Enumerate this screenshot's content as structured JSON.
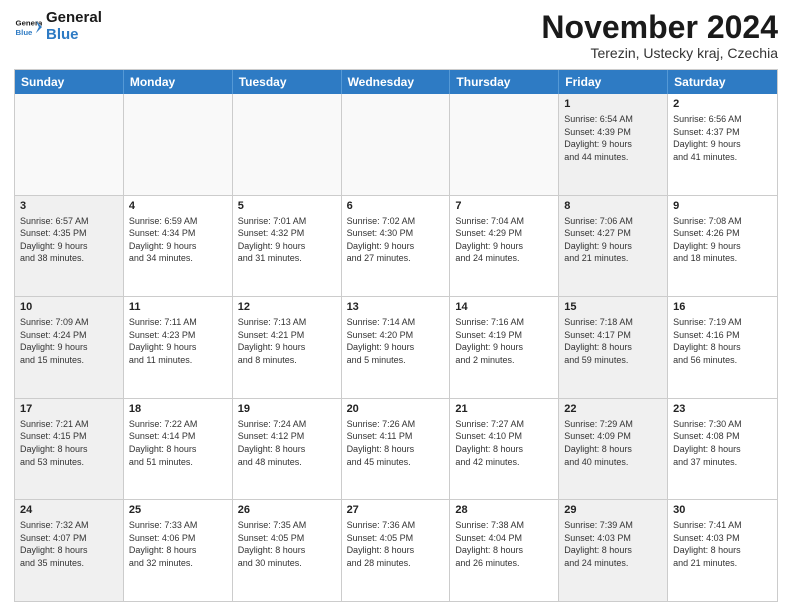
{
  "logo": {
    "line1": "General",
    "line2": "Blue"
  },
  "header": {
    "month": "November 2024",
    "location": "Terezin, Ustecky kraj, Czechia"
  },
  "weekdays": [
    "Sunday",
    "Monday",
    "Tuesday",
    "Wednesday",
    "Thursday",
    "Friday",
    "Saturday"
  ],
  "rows": [
    [
      {
        "day": "",
        "info": "",
        "empty": true
      },
      {
        "day": "",
        "info": "",
        "empty": true
      },
      {
        "day": "",
        "info": "",
        "empty": true
      },
      {
        "day": "",
        "info": "",
        "empty": true
      },
      {
        "day": "",
        "info": "",
        "empty": true
      },
      {
        "day": "1",
        "info": "Sunrise: 6:54 AM\nSunset: 4:39 PM\nDaylight: 9 hours\nand 44 minutes.",
        "shaded": true
      },
      {
        "day": "2",
        "info": "Sunrise: 6:56 AM\nSunset: 4:37 PM\nDaylight: 9 hours\nand 41 minutes.",
        "shaded": false
      }
    ],
    [
      {
        "day": "3",
        "info": "Sunrise: 6:57 AM\nSunset: 4:35 PM\nDaylight: 9 hours\nand 38 minutes.",
        "shaded": true
      },
      {
        "day": "4",
        "info": "Sunrise: 6:59 AM\nSunset: 4:34 PM\nDaylight: 9 hours\nand 34 minutes.",
        "shaded": false
      },
      {
        "day": "5",
        "info": "Sunrise: 7:01 AM\nSunset: 4:32 PM\nDaylight: 9 hours\nand 31 minutes.",
        "shaded": false
      },
      {
        "day": "6",
        "info": "Sunrise: 7:02 AM\nSunset: 4:30 PM\nDaylight: 9 hours\nand 27 minutes.",
        "shaded": false
      },
      {
        "day": "7",
        "info": "Sunrise: 7:04 AM\nSunset: 4:29 PM\nDaylight: 9 hours\nand 24 minutes.",
        "shaded": false
      },
      {
        "day": "8",
        "info": "Sunrise: 7:06 AM\nSunset: 4:27 PM\nDaylight: 9 hours\nand 21 minutes.",
        "shaded": true
      },
      {
        "day": "9",
        "info": "Sunrise: 7:08 AM\nSunset: 4:26 PM\nDaylight: 9 hours\nand 18 minutes.",
        "shaded": false
      }
    ],
    [
      {
        "day": "10",
        "info": "Sunrise: 7:09 AM\nSunset: 4:24 PM\nDaylight: 9 hours\nand 15 minutes.",
        "shaded": true
      },
      {
        "day": "11",
        "info": "Sunrise: 7:11 AM\nSunset: 4:23 PM\nDaylight: 9 hours\nand 11 minutes.",
        "shaded": false
      },
      {
        "day": "12",
        "info": "Sunrise: 7:13 AM\nSunset: 4:21 PM\nDaylight: 9 hours\nand 8 minutes.",
        "shaded": false
      },
      {
        "day": "13",
        "info": "Sunrise: 7:14 AM\nSunset: 4:20 PM\nDaylight: 9 hours\nand 5 minutes.",
        "shaded": false
      },
      {
        "day": "14",
        "info": "Sunrise: 7:16 AM\nSunset: 4:19 PM\nDaylight: 9 hours\nand 2 minutes.",
        "shaded": false
      },
      {
        "day": "15",
        "info": "Sunrise: 7:18 AM\nSunset: 4:17 PM\nDaylight: 8 hours\nand 59 minutes.",
        "shaded": true
      },
      {
        "day": "16",
        "info": "Sunrise: 7:19 AM\nSunset: 4:16 PM\nDaylight: 8 hours\nand 56 minutes.",
        "shaded": false
      }
    ],
    [
      {
        "day": "17",
        "info": "Sunrise: 7:21 AM\nSunset: 4:15 PM\nDaylight: 8 hours\nand 53 minutes.",
        "shaded": true
      },
      {
        "day": "18",
        "info": "Sunrise: 7:22 AM\nSunset: 4:14 PM\nDaylight: 8 hours\nand 51 minutes.",
        "shaded": false
      },
      {
        "day": "19",
        "info": "Sunrise: 7:24 AM\nSunset: 4:12 PM\nDaylight: 8 hours\nand 48 minutes.",
        "shaded": false
      },
      {
        "day": "20",
        "info": "Sunrise: 7:26 AM\nSunset: 4:11 PM\nDaylight: 8 hours\nand 45 minutes.",
        "shaded": false
      },
      {
        "day": "21",
        "info": "Sunrise: 7:27 AM\nSunset: 4:10 PM\nDaylight: 8 hours\nand 42 minutes.",
        "shaded": false
      },
      {
        "day": "22",
        "info": "Sunrise: 7:29 AM\nSunset: 4:09 PM\nDaylight: 8 hours\nand 40 minutes.",
        "shaded": true
      },
      {
        "day": "23",
        "info": "Sunrise: 7:30 AM\nSunset: 4:08 PM\nDaylight: 8 hours\nand 37 minutes.",
        "shaded": false
      }
    ],
    [
      {
        "day": "24",
        "info": "Sunrise: 7:32 AM\nSunset: 4:07 PM\nDaylight: 8 hours\nand 35 minutes.",
        "shaded": true
      },
      {
        "day": "25",
        "info": "Sunrise: 7:33 AM\nSunset: 4:06 PM\nDaylight: 8 hours\nand 32 minutes.",
        "shaded": false
      },
      {
        "day": "26",
        "info": "Sunrise: 7:35 AM\nSunset: 4:05 PM\nDaylight: 8 hours\nand 30 minutes.",
        "shaded": false
      },
      {
        "day": "27",
        "info": "Sunrise: 7:36 AM\nSunset: 4:05 PM\nDaylight: 8 hours\nand 28 minutes.",
        "shaded": false
      },
      {
        "day": "28",
        "info": "Sunrise: 7:38 AM\nSunset: 4:04 PM\nDaylight: 8 hours\nand 26 minutes.",
        "shaded": false
      },
      {
        "day": "29",
        "info": "Sunrise: 7:39 AM\nSunset: 4:03 PM\nDaylight: 8 hours\nand 24 minutes.",
        "shaded": true
      },
      {
        "day": "30",
        "info": "Sunrise: 7:41 AM\nSunset: 4:03 PM\nDaylight: 8 hours\nand 21 minutes.",
        "shaded": false
      }
    ]
  ]
}
